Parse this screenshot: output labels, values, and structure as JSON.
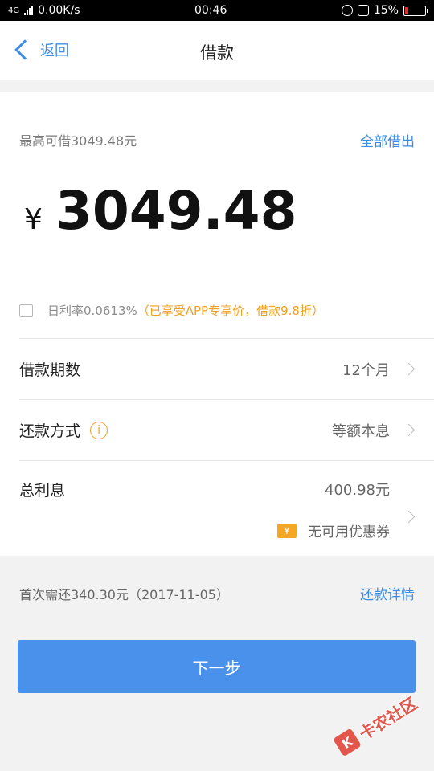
{
  "status_bar": {
    "network": "4G",
    "speed": "0.00K/s",
    "time": "00:46",
    "battery": "15%",
    "battery_level": 0.15,
    "battery_color": "#e0302d"
  },
  "navbar": {
    "back_label": "返回",
    "title": "借款"
  },
  "loan": {
    "max_label": "最高可借3049.48元",
    "borrow_all": "全部借出",
    "currency": "¥",
    "amount": "3049.48",
    "rate_text": "日利率0.0613%",
    "rate_promo": "（已享受APP专享价，借款9.8折）"
  },
  "rows": [
    {
      "label": "借款期数",
      "value": "12个月"
    },
    {
      "label": "还款方式",
      "value": "等额本息"
    }
  ],
  "interest": {
    "label": "总利息",
    "amount": "400.98元",
    "coupon_icon": "¥",
    "coupon_text": "无可用优惠券"
  },
  "repay": {
    "first_repay": "首次需还340.30元（2017-11-05）",
    "detail_link": "还款详情"
  },
  "next_button": "下一步",
  "watermark": {
    "logo": "K",
    "text": "卡农社区"
  },
  "colors": {
    "accent": "#3d8de6",
    "button": "#4a91eb",
    "promo": "#f0a020"
  }
}
